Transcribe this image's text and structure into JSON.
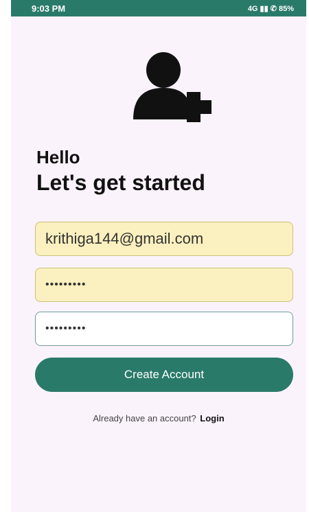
{
  "status_bar": {
    "time": "9:03 PM",
    "indicators": "4G ▮▮ ✆ 85%"
  },
  "icons": {
    "header_icon": "add-user-icon"
  },
  "greeting": {
    "line1": "Hello",
    "line2": "Let's get started"
  },
  "form": {
    "email_value": "krithiga144@gmail.com",
    "password_value": "•••••••••",
    "confirm_password_value": "•••••••••"
  },
  "buttons": {
    "create_account": "Create Account"
  },
  "footer": {
    "prompt": "Already have an account?",
    "login_label": "Login"
  },
  "colors": {
    "accent": "#2a7a6a",
    "background": "#fbf3fb",
    "autofill": "#fbf0bf"
  }
}
